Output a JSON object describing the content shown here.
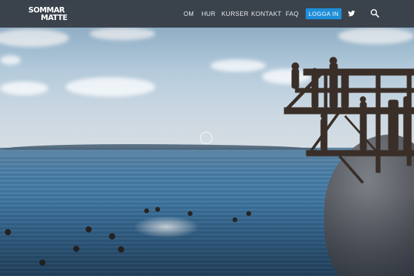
{
  "site": {
    "logo_line1": "SOMMAR",
    "logo_line2": "MATTE"
  },
  "nav": {
    "items": [
      {
        "label": "OM"
      },
      {
        "label": "HUR"
      },
      {
        "label": "KURSER"
      },
      {
        "label": "KONTAKT"
      },
      {
        "label": "FAQ"
      }
    ],
    "login_label": "LOGGA IN",
    "icons": [
      "twitter-icon",
      "search-icon"
    ]
  },
  "colors": {
    "header_bg": "#343a42",
    "accent": "#1f8ed8",
    "text": "#ffffff"
  },
  "hero": {
    "image": "people swimming in the sea by a wooden diving tower on a rock"
  }
}
